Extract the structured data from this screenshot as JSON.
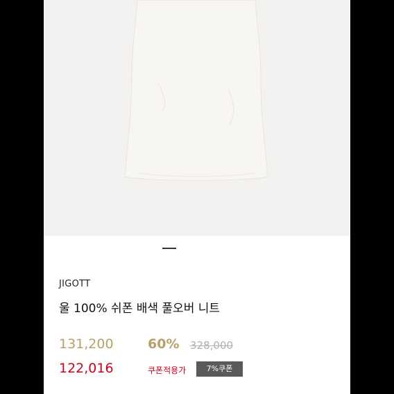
{
  "product": {
    "brand": "JIGOTT",
    "title": "울 100% 쉬폰 배색 풀오버 니트",
    "image_icon": "white-sleeveless-knit"
  },
  "pricing": {
    "sale_price": "131,200",
    "discount_rate": "60%",
    "list_price": "328,000",
    "coupon_price": "122,016",
    "coupon_label": "쿠폰적용가",
    "coupon_badge": "7%쿠폰"
  },
  "colors": {
    "gold": "#b9a06a",
    "red": "#d0021b",
    "badge_bg": "#5a5a5a"
  }
}
